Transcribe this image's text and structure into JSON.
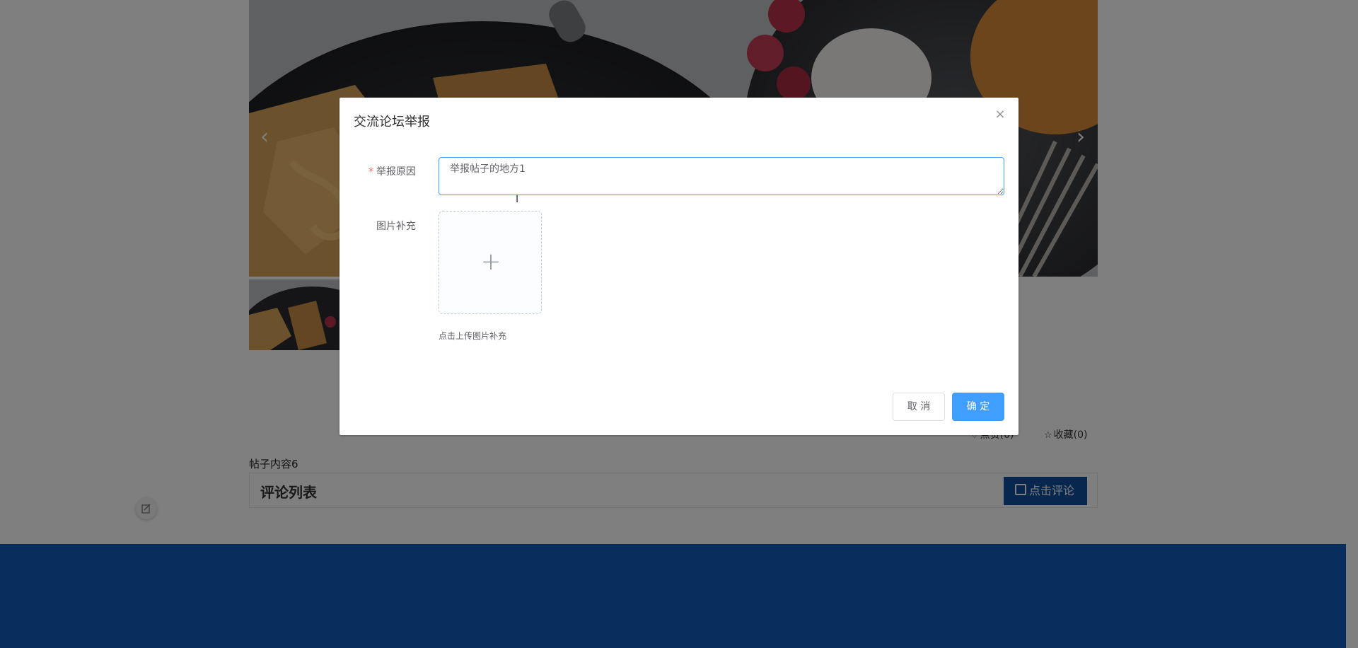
{
  "carousel": {
    "prev_icon": "chevron-left-icon",
    "next_icon": "chevron-right-icon"
  },
  "post": {
    "like_label": "点赞(0)",
    "favorite_label": "收藏(0)",
    "content": "帖子内容6"
  },
  "comments": {
    "title": "评论列表",
    "button_label": "点击评论",
    "button_color": "#0e4f9c"
  },
  "footer": {
    "color": "#0e5db8"
  },
  "dialog": {
    "title": "交流论坛举报",
    "close_icon": "close-icon",
    "reason_label": "举报原因",
    "reason_value": "举报帖子的地方1",
    "reason_required": true,
    "image_label": "图片补充",
    "upload_tip": "点击上传图片补充",
    "cancel_label": "取 消",
    "confirm_label": "确 定",
    "primary_color": "#409eff"
  }
}
